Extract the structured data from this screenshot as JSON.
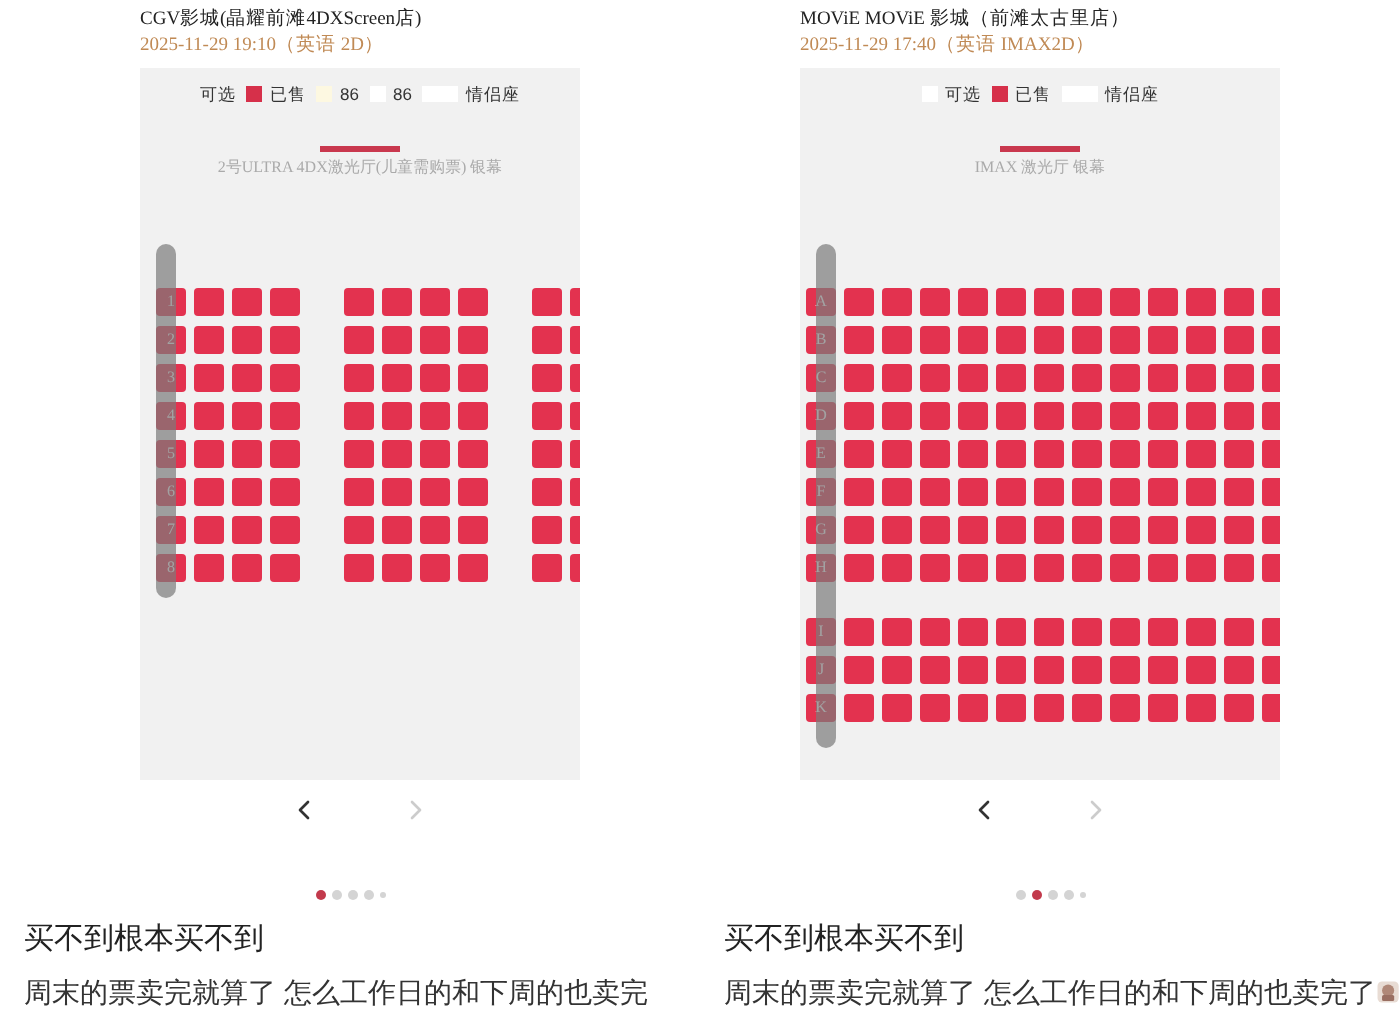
{
  "posts": [
    {
      "header": {
        "cinema": "CGV影城(晶耀前滩4DXScreen店)",
        "showtime": "2025-11-29 19:10（英语 2D）"
      },
      "legend": [
        {
          "kind": "none",
          "label": "可选"
        },
        {
          "kind": "single",
          "color": "#d6304a",
          "label": "已售"
        },
        {
          "kind": "single",
          "color": "#fdf8e1",
          "label": "86"
        },
        {
          "kind": "single",
          "color": "#ffffff",
          "label": "86"
        },
        {
          "kind": "couple",
          "color": "#ffffff",
          "label": "情侣座"
        }
      ],
      "screen": {
        "label": "2号ULTRA 4DX激光厅(儿童需购票) 银幕"
      },
      "seat_sections": [
        {
          "rows": [
            {
              "label": "1",
              "sold": true
            },
            {
              "label": "2",
              "sold": true
            },
            {
              "label": "3",
              "sold": true
            },
            {
              "label": "4",
              "sold": true
            },
            {
              "label": "5",
              "sold": true
            },
            {
              "label": "6",
              "sold": true
            },
            {
              "label": "7",
              "sold": true
            },
            {
              "label": "8",
              "sold": true
            }
          ]
        }
      ],
      "nav": {
        "prev": {
          "disabled": false
        },
        "next": {
          "disabled": true
        }
      },
      "dots": [
        {
          "selected": true
        },
        {
          "selected": false
        },
        {
          "selected": false
        },
        {
          "selected": false
        },
        {
          "selected": false
        }
      ],
      "title": "买不到根本买不到",
      "body": "周末的票卖完就算了 怎么工作日的和下周的也卖完"
    },
    {
      "header": {
        "cinema": "MOViE MOViE 影城（前滩太古里店）",
        "showtime": "2025-11-29 17:40（英语 IMAX2D）"
      },
      "legend": [
        {
          "kind": "single",
          "color": "#ffffff",
          "label": "可选"
        },
        {
          "kind": "single",
          "color": "#d6304a",
          "label": "已售"
        },
        {
          "kind": "couple",
          "color": "#ffffff",
          "label": "情侣座"
        }
      ],
      "screen": {
        "label": "IMAX 激光厅 银幕"
      },
      "seat_sections": [
        {
          "rows": [
            {
              "label": "A",
              "sold": true
            },
            {
              "label": "B",
              "sold": true
            },
            {
              "label": "C",
              "sold": true
            },
            {
              "label": "D",
              "sold": true
            },
            {
              "label": "E",
              "sold": true
            },
            {
              "label": "F",
              "sold": true
            },
            {
              "label": "G",
              "sold": true
            },
            {
              "label": "H",
              "sold": true
            }
          ]
        },
        {
          "rows": [
            {
              "label": "I",
              "sold": true
            },
            {
              "label": "J",
              "sold": true
            },
            {
              "label": "K",
              "sold": true
            }
          ]
        }
      ],
      "nav": {
        "prev": {
          "disabled": false
        },
        "next": {
          "disabled": true
        }
      },
      "dots": [
        {
          "selected": false
        },
        {
          "selected": true
        },
        {
          "selected": false
        },
        {
          "selected": false
        },
        {
          "selected": false
        }
      ],
      "title": "买不到根本买不到",
      "body": "周末的票卖完就算了 怎么工作日的和下周的也卖完了",
      "sticker": true
    }
  ]
}
